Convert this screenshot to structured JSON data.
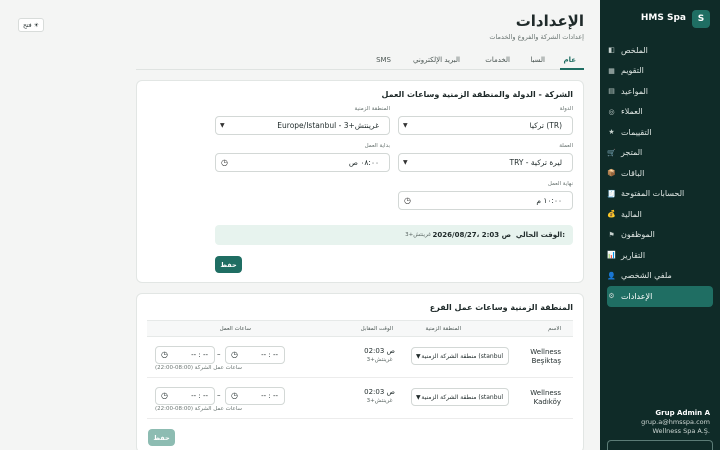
{
  "sidebar": {
    "brand_badge": "S",
    "brand_name": "HMS Spa",
    "items": [
      {
        "label": "الملخص",
        "icon": "dashboard-icon",
        "glyph": "◧",
        "active": false
      },
      {
        "label": "التقويم",
        "icon": "calendar-icon",
        "glyph": "▦",
        "active": false
      },
      {
        "label": "المواعيد",
        "icon": "appointments-icon",
        "glyph": "▤",
        "active": false
      },
      {
        "label": "العملاء",
        "icon": "customers-icon",
        "glyph": "◎",
        "active": false
      },
      {
        "label": "التقييمات",
        "icon": "star-icon",
        "glyph": "★",
        "active": false
      },
      {
        "label": "المتجر",
        "icon": "cart-icon",
        "glyph": "🛒",
        "active": false
      },
      {
        "label": "الباقات",
        "icon": "package-icon",
        "glyph": "📦",
        "active": false
      },
      {
        "label": "الحسابات المفتوحة",
        "icon": "receipt-icon",
        "glyph": "🧾",
        "active": false
      },
      {
        "label": "المالية",
        "icon": "money-bag-icon",
        "glyph": "💰",
        "active": false
      },
      {
        "label": "الموظفون",
        "icon": "flag-icon",
        "glyph": "⚑",
        "active": false
      },
      {
        "label": "التقارير",
        "icon": "chart-icon",
        "glyph": "📊",
        "active": false
      },
      {
        "label": "ملفي الشخصي",
        "icon": "user-icon",
        "glyph": "👤",
        "active": false
      },
      {
        "label": "الإعدادات",
        "icon": "gear-icon",
        "glyph": "⚙",
        "active": true
      }
    ],
    "user_name": "Grup Admin A",
    "user_email": "grup.a@hmsspa.com",
    "user_company": "Wellness Spa A.Ş."
  },
  "open_button": "فتح",
  "page": {
    "title": "الإعدادات",
    "subtitle": "إعدادات الشركة والفروع والخدمات"
  },
  "tabs": [
    "عام",
    "السبا",
    "الخدمات",
    "البريد الإلكتروني",
    "SMS"
  ],
  "company": {
    "title": "الشركة - الدولة والمنطقة الزمنية وساعات العمل",
    "country_label": "الدولة",
    "country_value": "تركيا (TR)",
    "timezone_label": "المنطقة الزمنية",
    "timezone_value": "Europe/Istanbul - غرينتش+3",
    "currency_label": "العملة",
    "currency_value": "TRY - ليرة تركية",
    "start_label": "بداية العمل",
    "start_value": "٠٨:٠٠ ص",
    "end_label": "نهاية العمل",
    "end_value": "١٠:٠٠ م",
    "current_time_label": "الوقت الحالي:",
    "current_time_value": "2026/08/27، 2:03 ص",
    "current_time_tz": "غرينتش+3",
    "save_label": "حفظ"
  },
  "branches": {
    "title": "المنطقة الزمنية وساعات عمل الفرع",
    "headers": {
      "name": "الاسم",
      "timezone": "المنطقة الزمنية",
      "local_time": "الوقت المقابل",
      "hours": "ساعات العمل"
    },
    "rows": [
      {
        "name": "Wellness Beşiktaş",
        "timezone": "منطقة الشركة الزمنية (stanbul",
        "time": "02:03 ص",
        "time_tz": "غرينتش+3",
        "start": "-- : --",
        "end": "-- : --",
        "hint": "ساعات عمل الشركة (08:00-22:00)"
      },
      {
        "name": "Wellness Kadıköy",
        "timezone": "منطقة الشركة الزمنية (stanbul",
        "time": "02:03 ص",
        "time_tz": "غرينتش+3",
        "start": "-- : --",
        "end": "-- : --",
        "hint": "ساعات عمل الشركة (08:00-22:00)"
      }
    ],
    "save_label": "حفظ"
  },
  "colors": {
    "sidebar": "#0f2b28",
    "accent": "#1f6e63",
    "info_bg": "#e7f3ee"
  }
}
